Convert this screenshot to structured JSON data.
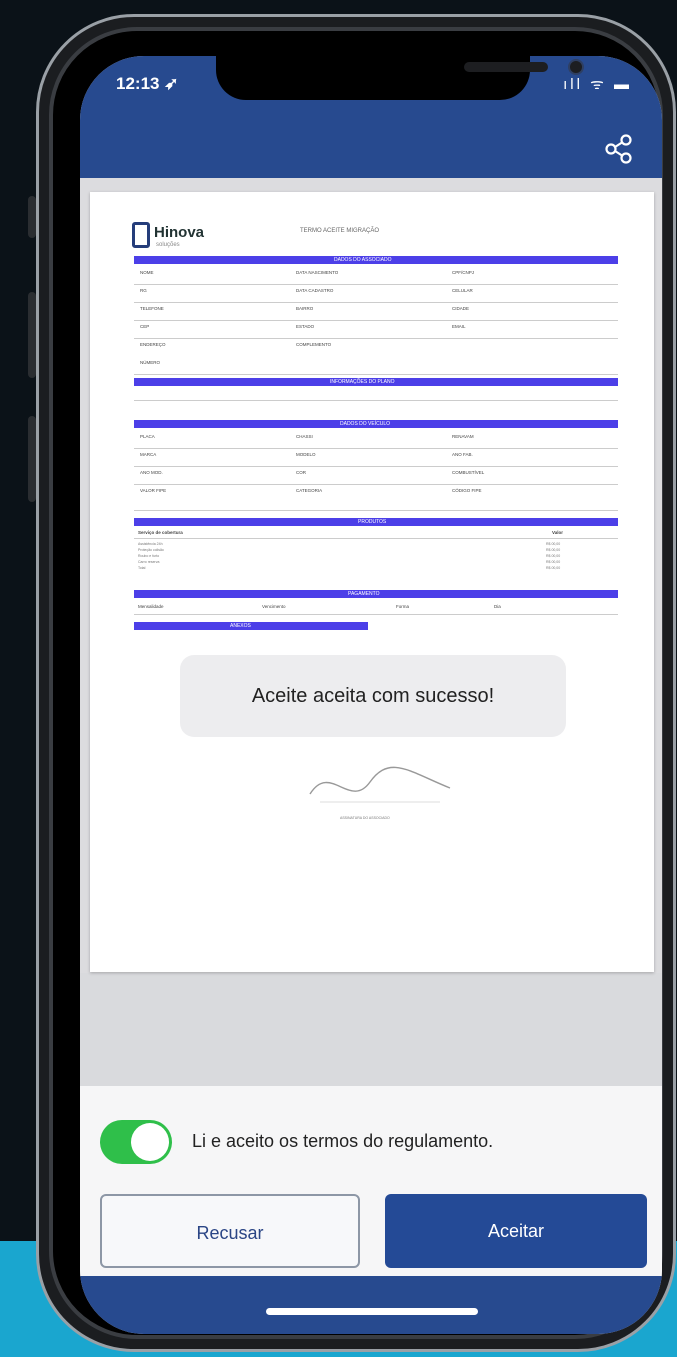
{
  "status_bar": {
    "time": "12:13 ➶",
    "icons": "ıll ᯤ ▬"
  },
  "header": {
    "share_icon": "share-icon"
  },
  "document": {
    "logo_text": "Hinova",
    "logo_sub": "soluções",
    "title": "TERMO ACEITE MIGRAÇÃO",
    "sections": [
      "DADOS DO ASSOCIADO",
      "INFORMAÇÕES DO PLANO",
      "DADOS DO VEÍCULO",
      "PRODUTOS",
      "PAGAMENTO",
      "ANEXOS"
    ],
    "fields": [
      "NOME",
      "DATA NASCIMENTO",
      "CPF/CNPJ",
      "RG",
      "DATA CADASTRO",
      "CELULAR",
      "TELEFONE",
      "BAIRRO",
      "CIDADE",
      "CEP",
      "ESTADO",
      "EMAIL",
      "ENDEREÇO",
      "COMPLEMENTO",
      "NÚMERO",
      "PLACA",
      "CHASSI",
      "RENAVAM",
      "MARCA",
      "MODELO",
      "ANO FAB.",
      "ANO MOD.",
      "COR",
      "COMBUSTÍVEL",
      "VALOR FIPE",
      "CATEGORIA",
      "CÓDIGO FIPE"
    ],
    "products_header": [
      "Serviço de cobertura",
      "Valor"
    ],
    "products": [
      {
        "name": "Assistência 24h",
        "value": "R$ 00,00"
      },
      {
        "name": "Proteção colisão",
        "value": "R$ 00,00"
      },
      {
        "name": "Roubo e furto",
        "value": "R$ 00,00"
      },
      {
        "name": "Carro reserva",
        "value": "R$ 00,00"
      },
      {
        "name": "Total",
        "value": "R$ 00,00"
      }
    ],
    "payment": [
      "Mensalidade",
      "Vencimento",
      "Forma",
      "Dia"
    ],
    "signature_caption": "ASSINATURA DO ASSOCIADO"
  },
  "toast": {
    "message": "Aceite aceita com sucesso!"
  },
  "terms": {
    "label": "Li e aceito os termos do regulamento.",
    "checked": true
  },
  "buttons": {
    "decline": "Recusar",
    "accept": "Aceitar"
  },
  "colors": {
    "brand": "#274a8f",
    "section": "#4c3fe8",
    "toggle_on": "#2fbf4a"
  }
}
